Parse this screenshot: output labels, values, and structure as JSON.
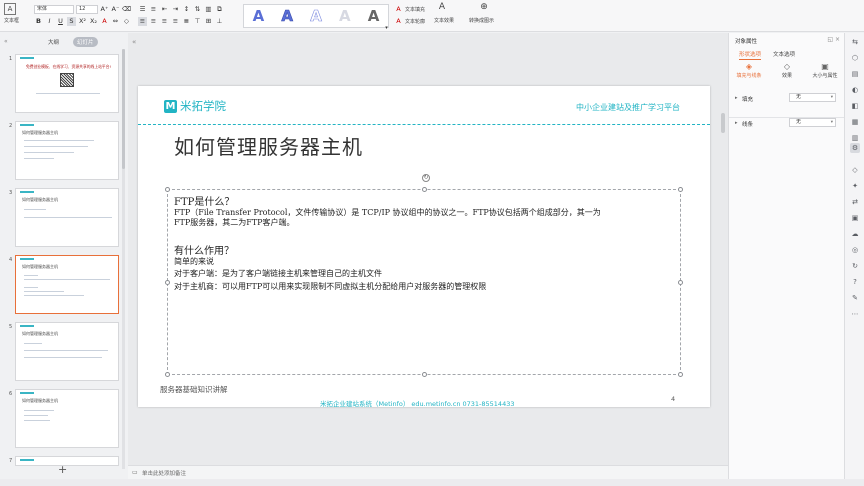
{
  "ribbon": {
    "text_box_label": "文本框",
    "font_name": "宋体",
    "font_size": "12",
    "convert_to_image_label": "转换成图示",
    "text_fill_label": "文本填充",
    "text_outline_label": "文本轮廓",
    "text_effect_label": "文本效果",
    "wordart_glyph": "A"
  },
  "thumb_panel": {
    "tab_outline": "大纲",
    "tab_slides": "幻灯片",
    "add_slide": "+",
    "slides": [
      {
        "num": "1",
        "title": "免费创业模板、在线学习、资源共享的线上站平台!"
      },
      {
        "num": "2",
        "title": "如何管理服务器主机"
      },
      {
        "num": "3",
        "title": "如何管理服务器主机"
      },
      {
        "num": "4",
        "title": "如何管理服务器主机"
      },
      {
        "num": "5",
        "title": "如何管理服务器主机"
      },
      {
        "num": "6",
        "title": "如何管理服务器主机"
      },
      {
        "num": "7",
        "title": ""
      }
    ]
  },
  "slide": {
    "logo_text": "米拓学院",
    "tagline": "中小企业建站及推广学习平台",
    "title": "如何管理服务器主机",
    "body": {
      "h1": "FTP是什么？",
      "p1": "FTP（File Transfer Protocol，文件传输协议）是 TCP/IP 协议组中的协议之一。FTP协议包括两个组成部分，其一为",
      "p2": "FTP服务器，其二为FTP客户端。",
      "h2": "有什么作用？",
      "p3": "简单的来说",
      "p4": "对于客户端：是为了客户端链接主机来管理自己的主机文件",
      "p5": "对于主机商：可以用FTP可以用来实现限制不同虚拟主机分配给用户对服务器的管理权限"
    },
    "footer_left": "服务器基础知识讲解",
    "footer_center": "米拓企业建站系统（Metinfo）   edu.metinfo.cn   0731-85514433",
    "page_num": "4"
  },
  "notes": {
    "placeholder": "单击此处添加备注"
  },
  "props": {
    "header": "对象属性",
    "tab_shape": "形状选项",
    "tab_text": "文本选项",
    "sub_fill_line": "填充与线条",
    "sub_effects": "效果",
    "sub_size": "大小与属性",
    "fill_label": "填充",
    "fill_value": "无",
    "line_label": "线条",
    "line_value": "无"
  },
  "colors": {
    "brand": "#22b4c4",
    "accent": "#e8703a"
  }
}
